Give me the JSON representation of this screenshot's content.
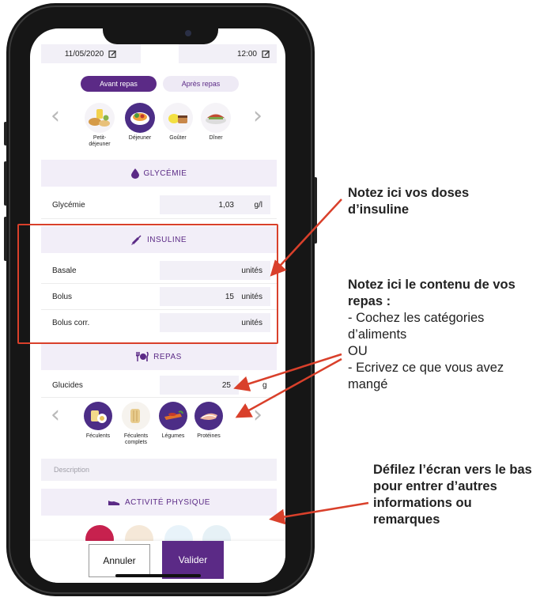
{
  "date_time": {
    "date": "11/05/2020",
    "time": "12:00"
  },
  "meal_phase": {
    "before": "Avant repas",
    "after": "Après repas",
    "active": "before"
  },
  "meal_types": [
    {
      "label": "Petit-\ndéjeuner",
      "selected": false
    },
    {
      "label": "Déjeuner",
      "selected": true
    },
    {
      "label": "Goûter",
      "selected": false
    },
    {
      "label": "Dîner",
      "selected": false
    }
  ],
  "glycemia": {
    "section_title": "GLYCÉMIE",
    "label": "Glycémie",
    "value": "1,03",
    "unit": "g/l"
  },
  "insulin": {
    "section_title": "INSULINE",
    "rows": [
      {
        "label": "Basale",
        "value": "",
        "unit": "unités"
      },
      {
        "label": "Bolus",
        "value": "15",
        "unit": "unités"
      },
      {
        "label": "Bolus corr.",
        "value": "",
        "unit": "unités"
      }
    ]
  },
  "meal": {
    "section_title": "REPAS",
    "carbs_label": "Glucides",
    "carbs_value": "25",
    "carbs_unit": "g",
    "food_categories": [
      {
        "label": "Féculents",
        "selected": true
      },
      {
        "label": "Féculents\ncomplets",
        "selected": false
      },
      {
        "label": "Légumes",
        "selected": true
      },
      {
        "label": "Protéines",
        "selected": true
      }
    ],
    "description_placeholder": "Description"
  },
  "activity": {
    "section_title": "ACTIVITÉ PHYSIQUE"
  },
  "buttons": {
    "cancel": "Annuler",
    "validate": "Valider"
  },
  "annotations": {
    "insulin": "Notez ici vos doses d’insuline",
    "meal_title": "Notez ici le contenu de vos repas :",
    "meal_line1": "- Cochez les catégories d’aliments",
    "meal_or": "OU",
    "meal_line2": "- Ecrivez ce que vous avez mangé",
    "scroll": "Défilez l’écran vers le bas pour entrer d’autres informations ou remarques"
  },
  "colors": {
    "accent": "#5b2a86",
    "annotation_red": "#d9402b",
    "field_bg": "#f2f0f7"
  }
}
